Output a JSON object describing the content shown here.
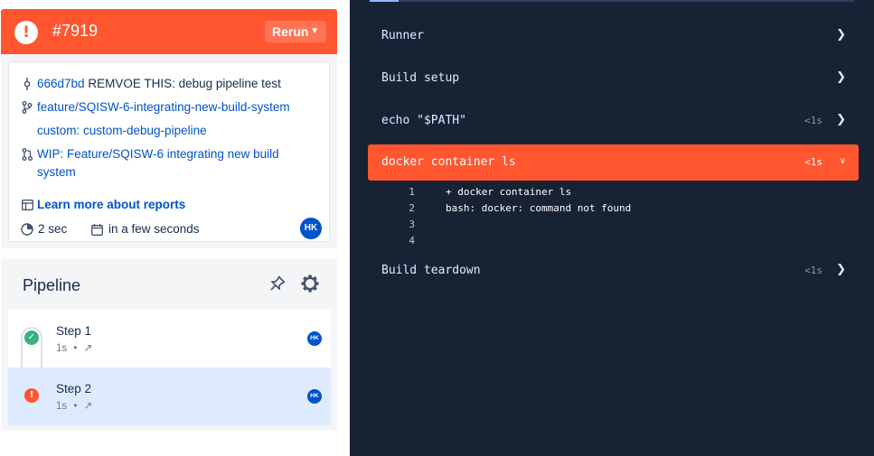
{
  "run": {
    "number": "#7919",
    "rerun_label": "Rerun",
    "status_color": "#ff5630"
  },
  "details": {
    "commit_hash": "666d7bd",
    "commit_message": "REMVOE THIS: debug pipeline test",
    "branch": "feature/SQISW-6-integrating-new-build-system",
    "custom_pipeline": "custom: custom-debug-pipeline",
    "pull_request": "WIP: Feature/SQISW-6 integrating new build system",
    "learn_more": "Learn more about reports",
    "duration": "2 sec",
    "started": "in a few seconds",
    "avatar_initials": "HK"
  },
  "pipeline": {
    "title": "Pipeline",
    "steps": [
      {
        "name": "Step 1",
        "duration": "1s",
        "status": "success",
        "avatar": "HK"
      },
      {
        "name": "Step 2",
        "duration": "1s",
        "status": "failed",
        "avatar": "HK"
      }
    ],
    "bullet": "•"
  },
  "log": {
    "sections": [
      {
        "label": "Runner",
        "duration": ""
      },
      {
        "label": "Build setup",
        "duration": ""
      },
      {
        "label": "echo \"$PATH\"",
        "duration": "<1s"
      },
      {
        "label": "docker container ls",
        "duration": "<1s",
        "expanded": true,
        "failed": true
      },
      {
        "label": "Build teardown",
        "duration": "<1s"
      }
    ],
    "lines": [
      {
        "n": "1",
        "text": "+ docker container ls"
      },
      {
        "n": "2",
        "text": "bash: docker: command not found"
      },
      {
        "n": "3",
        "text": ""
      },
      {
        "n": "4",
        "text": ""
      }
    ]
  },
  "colors": {
    "failed": "#ff5630",
    "success": "#36b37e",
    "link": "#0052cc",
    "log_bg": "#172235"
  }
}
